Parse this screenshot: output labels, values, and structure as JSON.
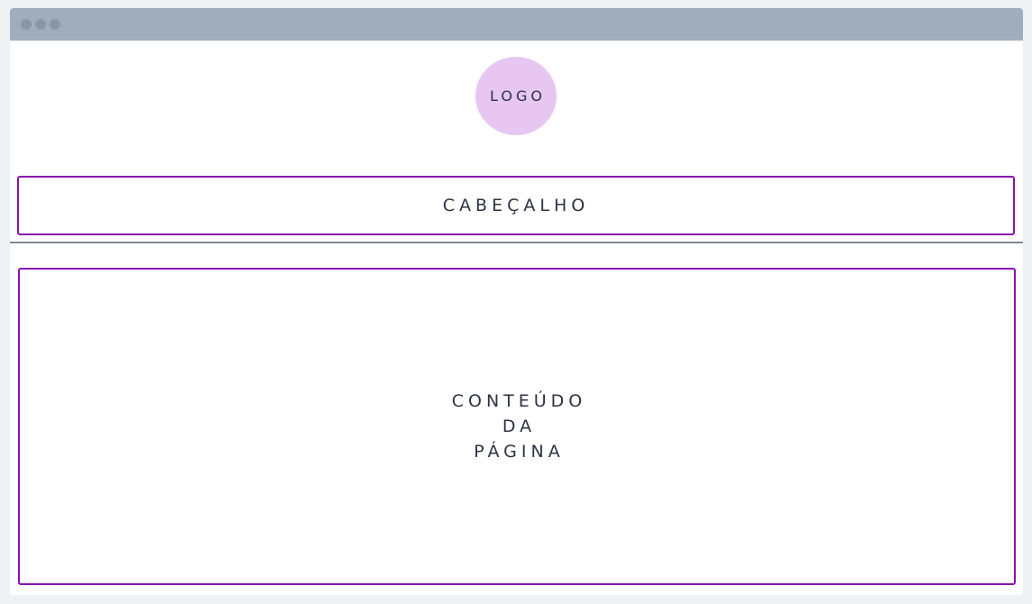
{
  "logo": {
    "label": "LOGO"
  },
  "header": {
    "label": "CABEÇALHO"
  },
  "content": {
    "lines": [
      "CONTEÚDO",
      "DA",
      "PÁGINA"
    ]
  },
  "colors": {
    "titlebar": "#a0adbc",
    "logo_fill": "#e7c6f2",
    "box_border": "#8a10b0",
    "divider": "#7c8898",
    "text": "#2d3344"
  }
}
